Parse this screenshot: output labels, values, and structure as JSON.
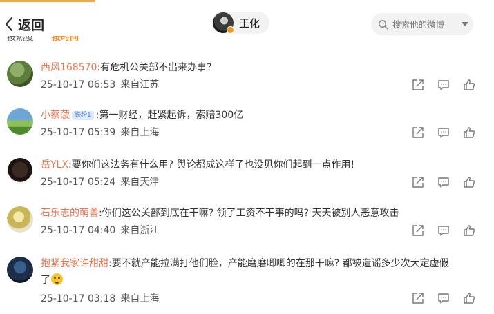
{
  "header": {
    "back_label": "返回",
    "user_name": "王化",
    "search_placeholder": "搜索他的微博"
  },
  "tabs": [
    {
      "label": "按热度",
      "active": false
    },
    {
      "label": "按时间",
      "active": true
    }
  ],
  "comments": [
    {
      "nick": "西风168570",
      "text": ":有危机公关部不出来办事?",
      "date": "25-10-17 06:53",
      "source": "来自江苏"
    },
    {
      "nick": "小蔡菠",
      "badge": "铁粉1",
      "text": ":第一财经，赶紧起诉，索赔300亿",
      "date": "25-10-17 05:39",
      "source": "来自上海"
    },
    {
      "nick": "岳YLX",
      "text": ":要你们这法务有什么用? 舆论都成这样了也没见你们起到一点作用!",
      "date": "25-10-17 05:24",
      "source": "来自天津"
    },
    {
      "nick": "石乐志的萌兽",
      "text": ":你们这公关部到底在干嘛? 领了工资不干事的吗? 天天被别人恶意攻击",
      "date": "25-10-17 04:40",
      "source": "来自浙江"
    },
    {
      "nick": "抱紧我家许甜甜",
      "text": ":要不就产能拉满打他们脸，产能磨磨唧唧的在那干嘛? 都被造谣多少次大定虚假",
      "text2": "了",
      "date": "25-10-17 03:18",
      "source": "来自上海"
    }
  ],
  "colors": {
    "accent": "#f28b1e",
    "nick": "#eb7350",
    "chip_bg": "#f2f2f2"
  }
}
